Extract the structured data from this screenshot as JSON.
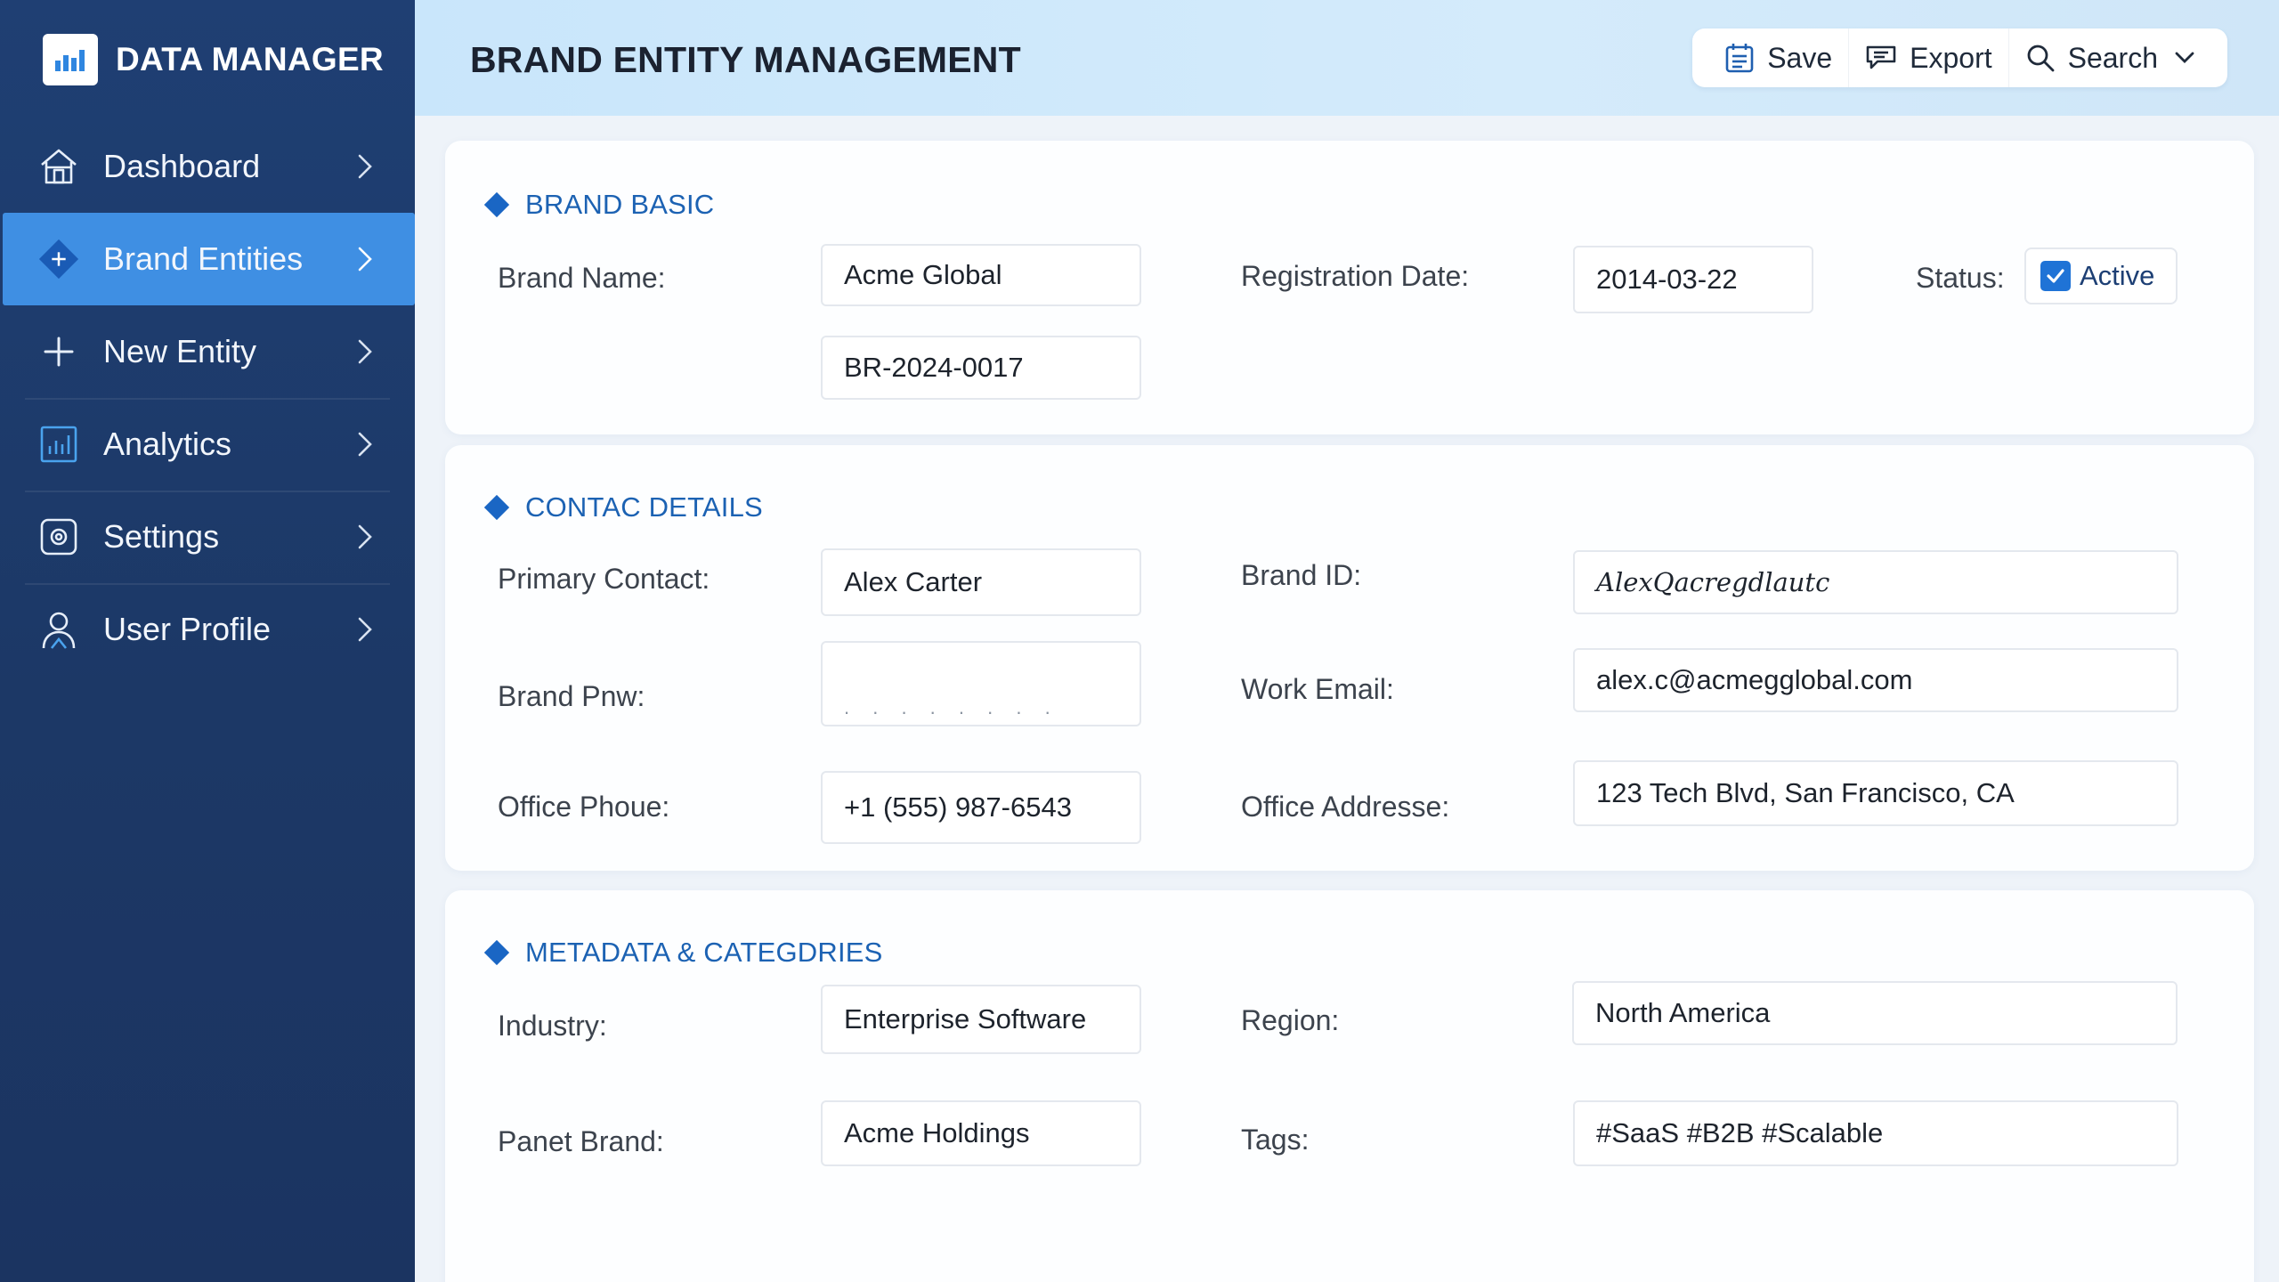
{
  "app": {
    "name": "DATA MANAGER",
    "logo_icon": "bar-chart-icon"
  },
  "sidebar": {
    "items": [
      {
        "label": "Dashboard",
        "icon": "home-icon",
        "active": false
      },
      {
        "label": "Brand Entities",
        "icon": "diamond-plus-icon",
        "active": true
      },
      {
        "label": "New Entity",
        "icon": "plus-icon",
        "active": false
      },
      {
        "label": "Analytics",
        "icon": "analytics-icon",
        "active": false
      },
      {
        "label": "Settings",
        "icon": "settings-icon",
        "active": false
      },
      {
        "label": "User Profile",
        "icon": "user-icon",
        "active": false
      }
    ]
  },
  "header": {
    "title": "BRAND ENTITY MANAGEMENT",
    "toolbar": {
      "save_label": "Save",
      "export_label": "Export",
      "search_label": "Search"
    }
  },
  "sections": {
    "basic": {
      "title": "BRAND BASIC",
      "brand_name_label": "Brand Name:",
      "brand_name_value": "Acme Global",
      "brand_code_value": "BR-2024-0017",
      "registration_date_label": "Registration Date:",
      "registration_date_value": "2014-03-22",
      "status_label": "Status:",
      "status_value": "Active",
      "status_checked": true
    },
    "contact": {
      "title": "CONTAC DETAILS",
      "primary_contact_label": "Primary Contact:",
      "primary_contact_value": "Alex Carter",
      "brand_id_label": "Brand ID:",
      "brand_id_value": "AlexQacregdlautc",
      "brand_pnw_label": "Brand Pnw:",
      "brand_pnw_value": ". . . . . . .   .",
      "work_email_label": "Work Email:",
      "work_email_value": "alex.c@acmegglobal.com",
      "office_phone_label": "Office Phoue:",
      "office_phone_value": "+1 (555) 987-6543",
      "office_address_label": "Office Addresse:",
      "office_address_value": "123 Tech Blvd, San Francisco, CA"
    },
    "metadata": {
      "title": "METADATA & CATEGDRIES",
      "industry_label": "Industry:",
      "industry_value": "Enterprise Software",
      "region_label": "Region:",
      "region_value": "North America",
      "parent_brand_label": "Panet Brand:",
      "parent_brand_value": "Acme Holdings",
      "tags_label": "Tags:",
      "tags_value": "#SaaS #B2B #Scalable"
    }
  },
  "colors": {
    "sidebar_bg": "#1f3f73",
    "active_item": "#3f8fe3",
    "accent": "#1c62b3",
    "header_bg": "#c9e6fb"
  }
}
